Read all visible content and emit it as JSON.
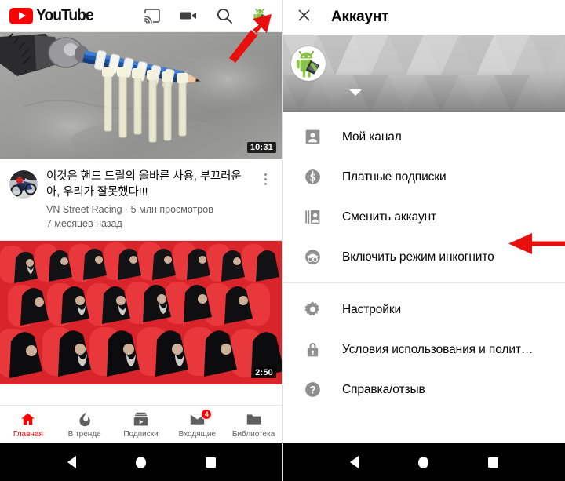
{
  "left_panel": {
    "topbar": {
      "logo_text": "YouTube",
      "icons": [
        {
          "name": "cast-icon",
          "label": "Cast"
        },
        {
          "name": "camera-icon",
          "label": "Upload video"
        },
        {
          "name": "search-icon",
          "label": "Search"
        },
        {
          "name": "account-avatar",
          "label": "Account"
        }
      ]
    },
    "videos": [
      {
        "duration": "10:31",
        "title": "이것은 핸드 드릴의 올바른 사용, 부끄러운 아, 우리가 잘못했다!!!",
        "channel": "VN Street Racing",
        "views": "5 млн просмотров",
        "age": "7 месяцев назад",
        "subtitle": "VN Street Racing · 5 млн просмотров",
        "thumbnail_desc": "drill-chuck-pencil-zipties"
      },
      {
        "duration": "2:50",
        "thumbnail_desc": "clergy-in-red-seats"
      }
    ],
    "bottom_nav": [
      {
        "label": "Главная",
        "icon": "home-icon",
        "active": true,
        "badge": ""
      },
      {
        "label": "В тренде",
        "icon": "trending-flame-icon",
        "active": false,
        "badge": ""
      },
      {
        "label": "Подписки",
        "icon": "subscriptions-icon",
        "active": false,
        "badge": ""
      },
      {
        "label": "Входящие",
        "icon": "inbox-icon",
        "active": false,
        "badge": "4"
      },
      {
        "label": "Библиотека",
        "icon": "library-folder-icon",
        "active": false,
        "badge": ""
      }
    ]
  },
  "right_panel": {
    "header": {
      "close_label": "✕",
      "title": "Аккаунт"
    },
    "banner": {
      "avatar_desc": "android-robot-with-tablet",
      "expand_caret": "▼"
    },
    "menu_group_1": [
      {
        "label": "Мой канал",
        "icon": "my-channel-icon"
      },
      {
        "label": "Платные подписки",
        "icon": "paid-subscriptions-icon"
      },
      {
        "label": "Сменить аккаунт",
        "icon": "switch-account-icon"
      },
      {
        "label": "Включить режим инкогнито",
        "icon": "incognito-icon"
      }
    ],
    "menu_group_2": [
      {
        "label": "Настройки",
        "icon": "settings-gear-icon"
      },
      {
        "label": "Условия использования и полит…",
        "icon": "lock-icon"
      },
      {
        "label": "Справка/отзыв",
        "icon": "help-question-icon"
      }
    ]
  },
  "system_nav": {
    "back": "back-triangle",
    "home": "home-circle",
    "recents": "recents-square"
  },
  "annotations": [
    {
      "name": "arrow-to-account-avatar",
      "color": "#e8100f",
      "direction": "up-right"
    },
    {
      "name": "arrow-to-incognito",
      "color": "#e8100f",
      "direction": "left"
    }
  ],
  "colors": {
    "youtube_red": "#ff0000",
    "annotation_red": "#e8100f",
    "text_primary": "#030303",
    "text_secondary": "#606060",
    "icon_gray": "#909090"
  }
}
